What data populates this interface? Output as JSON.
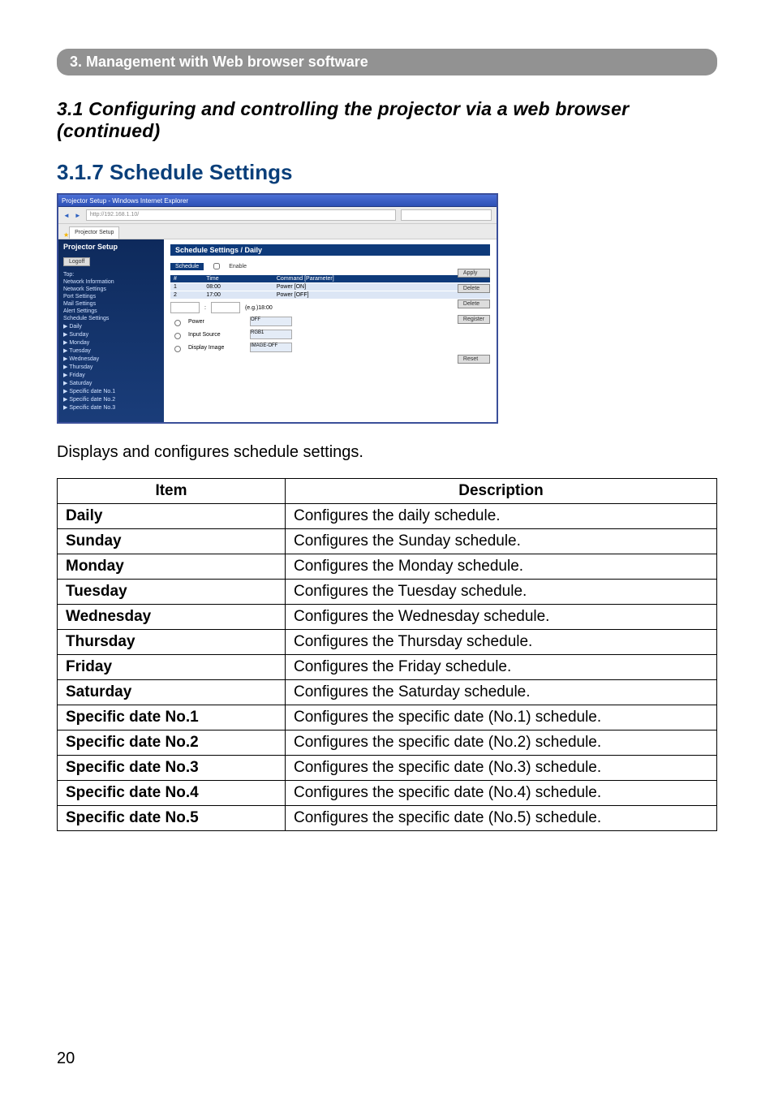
{
  "chapter_bar": "3. Management with Web browser software",
  "section_title": "3.1 Configuring and controlling the projector via a web browser (continued)",
  "subsection_title": "3.1.7 Schedule Settings",
  "caption": "Displays and configures schedule settings.",
  "page_number": "20",
  "screenshot": {
    "window_title": "Projector Setup - Windows Internet Explorer",
    "url": "http://192.168.1.10/",
    "tab": "Projector Setup",
    "sidebar": {
      "title": "Projector Setup",
      "logoff": "Logoff",
      "items": [
        "Top:",
        "Network Information",
        "Network Settings",
        "Port Settings",
        "Mail Settings",
        "Alert Settings",
        "Schedule Settings",
        "▶ Daily",
        "▶ Sunday",
        "▶ Monday",
        "▶ Tuesday",
        "▶ Wednesday",
        "▶ Thursday",
        "▶ Friday",
        "▶ Saturday",
        "▶ Specific date No.1",
        "▶ Specific date No.2",
        "▶ Specific date No.3"
      ]
    },
    "panel_title": "Schedule Settings / Daily",
    "schedule_label": "Schedule",
    "enable_label": "Enable",
    "apply_btn": "Apply",
    "table": {
      "headers": [
        "#",
        "Time",
        "Command [Parameter]"
      ],
      "rows": [
        {
          "num": "1",
          "time": "08:00",
          "cmd": "Power [ON]",
          "btn": "Delete"
        },
        {
          "num": "2",
          "time": "17:00",
          "cmd": "Power [OFF]",
          "btn": "Delete"
        }
      ]
    },
    "form": {
      "time_eg": "(e.g.)18:00",
      "opts": [
        {
          "label": "Power",
          "val": "OFF"
        },
        {
          "label": "Input Source",
          "val": "RGB1"
        },
        {
          "label": "Display Image",
          "val": "IMAGE-OFF"
        }
      ],
      "register_btn": "Register",
      "reset_btn": "Reset"
    }
  },
  "spec_table": {
    "headers": {
      "item": "Item",
      "desc": "Description"
    },
    "rows": [
      {
        "item": "Daily",
        "desc": "Configures the daily schedule."
      },
      {
        "item": "Sunday",
        "desc": "Configures the Sunday schedule."
      },
      {
        "item": "Monday",
        "desc": "Configures the Monday schedule."
      },
      {
        "item": "Tuesday",
        "desc": "Configures the Tuesday schedule."
      },
      {
        "item": "Wednesday",
        "desc": "Configures the Wednesday schedule."
      },
      {
        "item": "Thursday",
        "desc": "Configures the Thursday schedule."
      },
      {
        "item": "Friday",
        "desc": "Configures the Friday schedule."
      },
      {
        "item": "Saturday",
        "desc": "Configures the Saturday schedule."
      },
      {
        "item": "Specific date No.1",
        "desc": "Configures the specific date (No.1) schedule."
      },
      {
        "item": "Specific date No.2",
        "desc": "Configures the specific date (No.2) schedule."
      },
      {
        "item": "Specific date No.3",
        "desc": "Configures the specific date (No.3) schedule."
      },
      {
        "item": "Specific date No.4",
        "desc": "Configures the specific date (No.4) schedule."
      },
      {
        "item": "Specific date No.5",
        "desc": "Configures the specific date (No.5) schedule."
      }
    ]
  }
}
